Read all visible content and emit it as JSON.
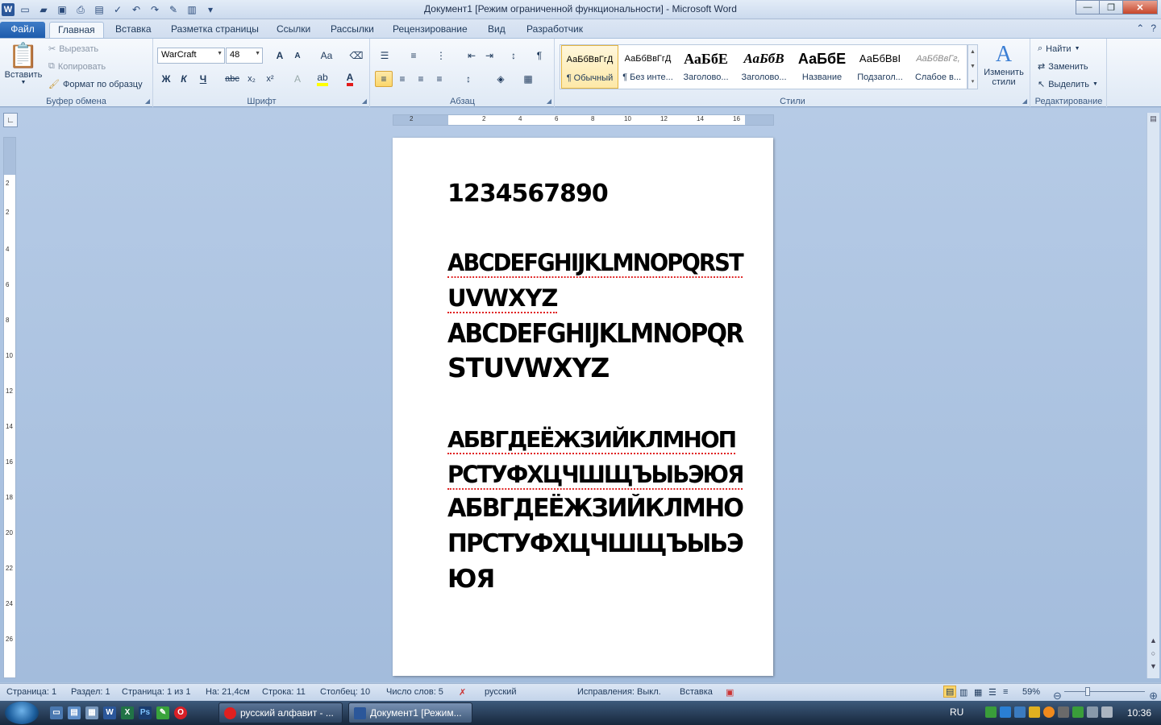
{
  "window": {
    "title": "Документ1 [Режим ограниченной функциональности]  -  Microsoft Word",
    "app_icon": "W"
  },
  "tabs": [
    "Файл",
    "Главная",
    "Вставка",
    "Разметка страницы",
    "Ссылки",
    "Рассылки",
    "Рецензирование",
    "Вид",
    "Разработчик"
  ],
  "ribbon": {
    "clipboard": {
      "label": "Буфер обмена",
      "paste": "Вставить",
      "cut": "Вырезать",
      "copy": "Копировать",
      "format_painter": "Формат по образцу"
    },
    "font": {
      "label": "Шрифт",
      "font_name": "WarCraft",
      "font_size": "48",
      "bold": "Ж",
      "italic": "К",
      "underline": "Ч",
      "strike": "abc",
      "subscript": "x₂",
      "superscript": "x²",
      "grow": "A",
      "shrink": "A",
      "case": "Aa",
      "font_color_accent": "#e21a1a",
      "highlight_accent": "#ffff00"
    },
    "paragraph": {
      "label": "Абзац",
      "pilcrow": "¶"
    },
    "styles": {
      "label": "Стили",
      "items": [
        {
          "preview": "АаБбВвГгД",
          "name": "¶ Обычный"
        },
        {
          "preview": "АаБбВвГгД",
          "name": "¶ Без инте..."
        },
        {
          "preview": "АаБбЕ",
          "name": "Заголово..."
        },
        {
          "preview": "АаБбВ",
          "name": "Заголово..."
        },
        {
          "preview": "АаБбЕ",
          "name": "Название"
        },
        {
          "preview": "АаБбВвІ",
          "name": "Подзагол..."
        },
        {
          "preview": "АаБбВвГг,",
          "name": "Слабое в..."
        }
      ],
      "change_styles": "Изменить стили"
    },
    "editing": {
      "label": "Редактирование",
      "find": "Найти",
      "replace": "Заменить",
      "select": "Выделить"
    }
  },
  "ruler": {
    "h_numbers": [
      "2",
      "2",
      "4",
      "6",
      "8",
      "10",
      "12",
      "14",
      "16"
    ],
    "v_numbers": [
      "2",
      "2",
      "4",
      "6",
      "8",
      "10",
      "12",
      "14",
      "16",
      "18",
      "20",
      "22",
      "24",
      "26"
    ]
  },
  "document": {
    "lines": [
      {
        "text": "1234567890",
        "spell_error": false
      },
      {
        "text": "ABCDEFGHIJKLMNOPQRST",
        "spell_error": true
      },
      {
        "text": "UVWXYZ",
        "spell_error": true
      },
      {
        "text": "ABCDEFGHIJKLMNOPQR",
        "spell_error": false
      },
      {
        "text": "STUVWXYZ",
        "spell_error": false
      },
      {
        "text": "АБВГДЕЁЖЗИЙКЛМНОП",
        "spell_error": true
      },
      {
        "text": "РСТУФХЦЧШЩЪЫЬЭЮЯ",
        "spell_error": true
      },
      {
        "text": "АБВГДЕЁЖЗИЙКЛМНО",
        "spell_error": false
      },
      {
        "text": "ПРСТУФХЦЧШЩЪЫЬЭ",
        "spell_error": false
      },
      {
        "text": "ЮЯ",
        "spell_error": false
      }
    ]
  },
  "status": {
    "page": "Страница: 1",
    "section": "Раздел: 1",
    "pages": "Страница: 1 из 1",
    "at": "На: 21,4см",
    "line": "Строка: 11",
    "column": "Столбец: 10",
    "words": "Число слов: 5",
    "language": "русский",
    "track_changes": "Исправления: Выкл.",
    "insert_mode": "Вставка",
    "zoom": "59%"
  },
  "taskbar": {
    "tasks": [
      {
        "label": "русский алфавит - ...",
        "icon_color": "#e02020"
      },
      {
        "label": "Документ1 [Режим...",
        "icon_color": "#2b579a"
      }
    ],
    "language": "RU",
    "clock": "10:36"
  }
}
